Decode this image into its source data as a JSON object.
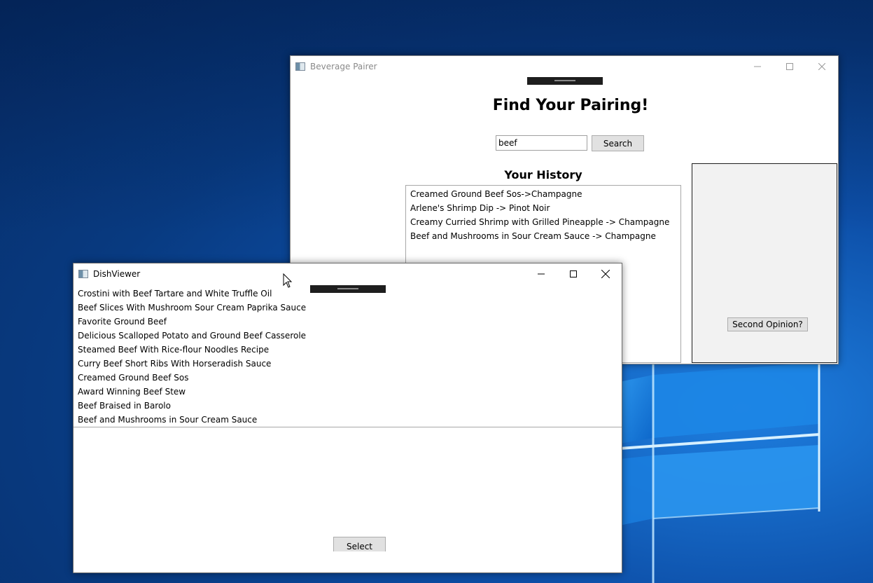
{
  "pairer": {
    "title": "Beverage Pairer",
    "heading": "Find Your Pairing!",
    "search": {
      "value": "beef",
      "button_label": "Search"
    },
    "history_heading": "Your History",
    "history": [
      "Creamed Ground Beef Sos->Champagne",
      "Arlene's Shrimp Dip -> Pinot Noir",
      "Creamy Curried Shrimp with Grilled Pineapple -> Champagne",
      "Beef and Mushrooms in Sour Cream Sauce -> Champagne"
    ],
    "second_opinion_label": "Second Opinion?"
  },
  "viewer": {
    "title": "DishViewer",
    "dishes": [
      "Crostini with Beef Tartare and White Truffle Oil",
      "Beef  Slices With Mushroom Sour Cream Paprika Sauce",
      "Favorite Ground Beef",
      "Delicious Scalloped Potato and Ground Beef Casserole",
      "Steamed Beef With Rice-flour Noodles Recipe",
      "Curry Beef Short Ribs With Horseradish Sauce",
      "Creamed Ground Beef Sos",
      "Award Winning Beef Stew",
      "Beef Braised in Barolo",
      "Beef and Mushrooms in Sour Cream Sauce"
    ],
    "select_label": "Select"
  },
  "icons": [
    "app-icon",
    "minimize-icon",
    "maximize-icon",
    "close-icon",
    "mouse-cursor-icon"
  ]
}
